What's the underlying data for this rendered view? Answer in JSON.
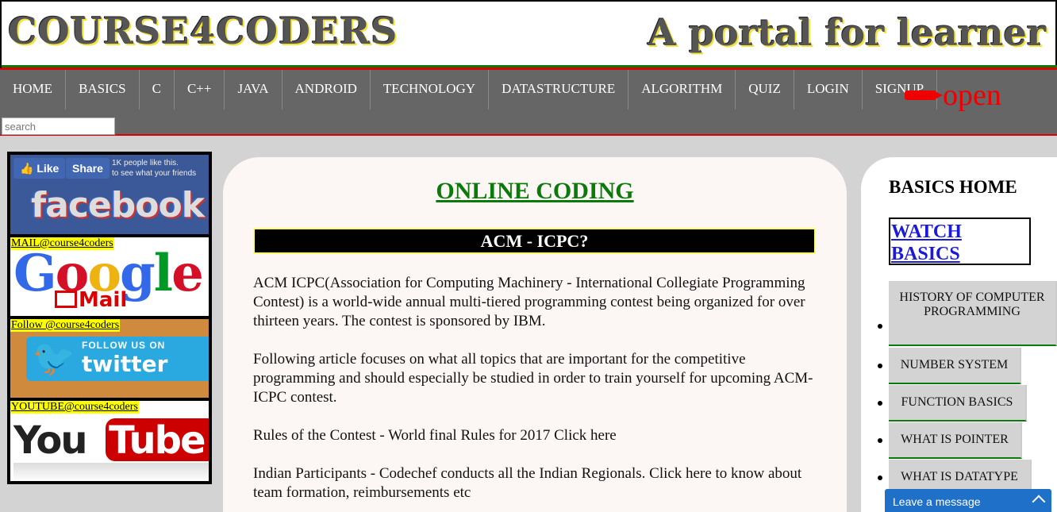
{
  "header": {
    "brand": "COURSE4CODERS",
    "tagline": "A portal for learner"
  },
  "nav": {
    "items": [
      "HOME",
      "BASICS",
      "C",
      "C++",
      "JAVA",
      "ANDROID",
      "TECHNOLOGY",
      "DATASTRUCTURE",
      "ALGORITHM",
      "QUIZ",
      "LOGIN",
      "SIGNUP"
    ],
    "open_label": "open",
    "open_icon": "pencil-icon",
    "search_placeholder": "search"
  },
  "social": {
    "facebook": {
      "like_label": "Like",
      "share_label": "Share",
      "count_text": "1K people like this.",
      "count_text2": "to see what your friends",
      "logo_text": "facebook"
    },
    "gmail": {
      "label": "MAIL@course4coders",
      "logo_letters": [
        "G",
        "o",
        "o",
        "g",
        "l",
        "e"
      ],
      "mail_text": "Mail"
    },
    "twitter": {
      "label": "Follow @course4coders",
      "follow_text": "FOLLOW US ON",
      "logo_text": "twitter"
    },
    "youtube": {
      "label": "YOUTUBE@course4coders",
      "you_text": "You",
      "tube_text": "Tube"
    }
  },
  "main": {
    "title": "ONLINE CODING",
    "section_heading": "ACM - ICPC?",
    "paragraphs": [
      "ACM ICPC(Association for Computing Machinery - International Collegiate Programming Contest) is a world-wide annual multi-tiered programming contest being organized for over thirteen years. The contest is sponsored by IBM.",
      "Following article focuses on what all topics that are important for the competitive programming and should especially be studied in order to train yourself for upcoming ACM-ICPC contest.",
      "Rules of the Contest - World final Rules for 2017 Click here",
      "Indian Participants - Codechef conducts all the Indian Regionals. Click here to know about team formation, reimbursements etc"
    ]
  },
  "sidebar": {
    "heading": "BASICS HOME",
    "watch_label_1": "WATCH",
    "watch_label_2": "BASICS",
    "items": [
      "HISTORY OF COMPUTER PROGRAMMING",
      "NUMBER SYSTEM",
      "FUNCTION BASICS",
      "WHAT IS POINTER",
      "WHAT IS DATATYPE"
    ]
  },
  "chat": {
    "label": "Leave a message"
  },
  "colors": {
    "nav_bg": "#666666",
    "accent_red": "#dd0000",
    "title_green": "#0a7a0a",
    "chat_blue": "#1e70c9"
  }
}
